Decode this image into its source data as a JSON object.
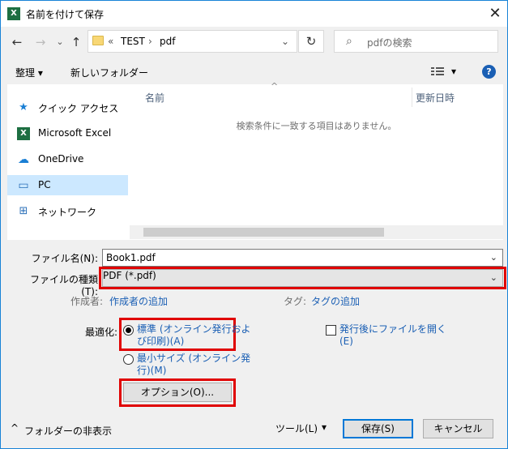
{
  "window": {
    "title": "名前を付けて保存",
    "app_icon": "X"
  },
  "nav": {
    "back": "←",
    "forward": "→",
    "recent": "⌄",
    "up": "↑",
    "breadcrumb_prefix": "«",
    "crumb1": "TEST",
    "sep": "›",
    "crumb2": "pdf",
    "dropdown": "⌄",
    "refresh": "↻",
    "search_placeholder": "pdfの検索"
  },
  "toolbar": {
    "organize": "整理 ▾",
    "new_folder": "新しいフォルダー",
    "view_arrow": "▾",
    "help": "?"
  },
  "sidebar": {
    "items": [
      {
        "label": "クイック アクセス",
        "icon": "★"
      },
      {
        "label": "Microsoft Excel",
        "icon": "X"
      },
      {
        "label": "OneDrive",
        "icon": "☁"
      },
      {
        "label": "PC",
        "icon": "▭"
      },
      {
        "label": "ネットワーク",
        "icon": "⊞"
      }
    ]
  },
  "filelist": {
    "sort_arrow": "^",
    "col_name": "名前",
    "col_date": "更新日時",
    "empty_message": "検索条件に一致する項目はありません。"
  },
  "form": {
    "filename_label": "ファイル名(N):",
    "filename_value": "Book1.pdf",
    "filetype_label": "ファイルの種類(T):",
    "filetype_value": "PDF (*.pdf)",
    "author_label": "作成者:",
    "author_link": "作成者の追加",
    "tags_label": "タグ:",
    "tags_link": "タグの追加",
    "optimize_label": "最適化:",
    "opt_standard_line1": "標準 (オンライン発行およ",
    "opt_standard_line2": "び印刷)(A)",
    "opt_min_line1": "最小サイズ (オンライン発",
    "opt_min_line2": "行)(M)",
    "open_after_line1": "発行後にファイルを開く",
    "open_after_line2": "(E)",
    "options_button": "オプション(O)..."
  },
  "footer": {
    "hide_folders": "フォルダーの非表示",
    "tools": "ツール(L)",
    "tools_arrow": "▾",
    "save": "保存(S)",
    "cancel": "キャンセル"
  },
  "colors": {
    "highlight_red": "#e00000",
    "link_blue": "#1a5fb4",
    "selected_bg": "#cce8ff"
  }
}
